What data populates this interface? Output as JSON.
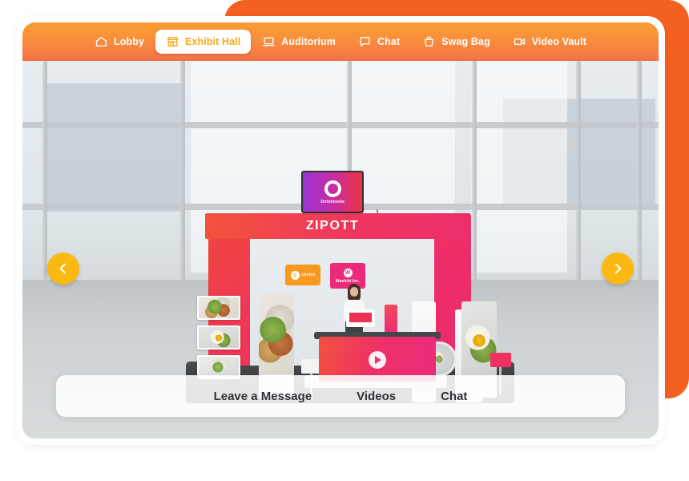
{
  "nav": {
    "items": [
      {
        "label": "Lobby",
        "icon": "home-icon",
        "active": false
      },
      {
        "label": "Exhibit Hall",
        "icon": "storefront-icon",
        "active": true
      },
      {
        "label": "Auditorium",
        "icon": "laptop-icon",
        "active": false
      },
      {
        "label": "Chat",
        "icon": "chat-bubble-icon",
        "active": false
      },
      {
        "label": "Swag Bag",
        "icon": "shopping-bag-icon",
        "active": false
      },
      {
        "label": "Video Vault",
        "icon": "video-camera-icon",
        "active": false
      }
    ]
  },
  "booth": {
    "banner_title": "ZIPOTT",
    "hanging_screen": {
      "logo": "ring-logo",
      "caption": "Ontotmedia"
    },
    "signs": [
      {
        "name": "circleo",
        "label": "circleo",
        "mark": "c",
        "color": "#f79a1f"
      },
      {
        "name": "waelchi",
        "label": "Waelchi Inc.",
        "mark": "W",
        "color": "#ec2a7a"
      }
    ],
    "counter": {
      "icon": "play-button-icon"
    },
    "thumbnails": [
      {
        "alt": "salad-bowl-photo"
      },
      {
        "alt": "avocado-toast-egg-photo"
      },
      {
        "alt": "plated-salad-photo"
      }
    ],
    "kiosk_left": {
      "alt": "salad-banner-photo"
    },
    "kiosk_right": {
      "alt": "avocado-toast-banner-photo"
    },
    "round_display": {
      "alt": "plate-display-photo"
    }
  },
  "carousel": {
    "prev": {
      "name": "previous-booth",
      "icon": "chevron-left-icon"
    },
    "next": {
      "name": "next-booth",
      "icon": "chevron-right-icon"
    }
  },
  "actions": {
    "items": [
      {
        "label": "Leave a Message"
      },
      {
        "label": "Videos"
      },
      {
        "label": "Chat"
      }
    ]
  },
  "colors": {
    "nav_gradient_start": "#fb9c34",
    "nav_gradient_end": "#f4714a",
    "accent_orange": "#f4601f",
    "active_tab_text": "#f7a81b",
    "arrow_yellow": "#fcb813",
    "booth_pink": "#ec2a7a",
    "booth_red": "#f0473d"
  }
}
